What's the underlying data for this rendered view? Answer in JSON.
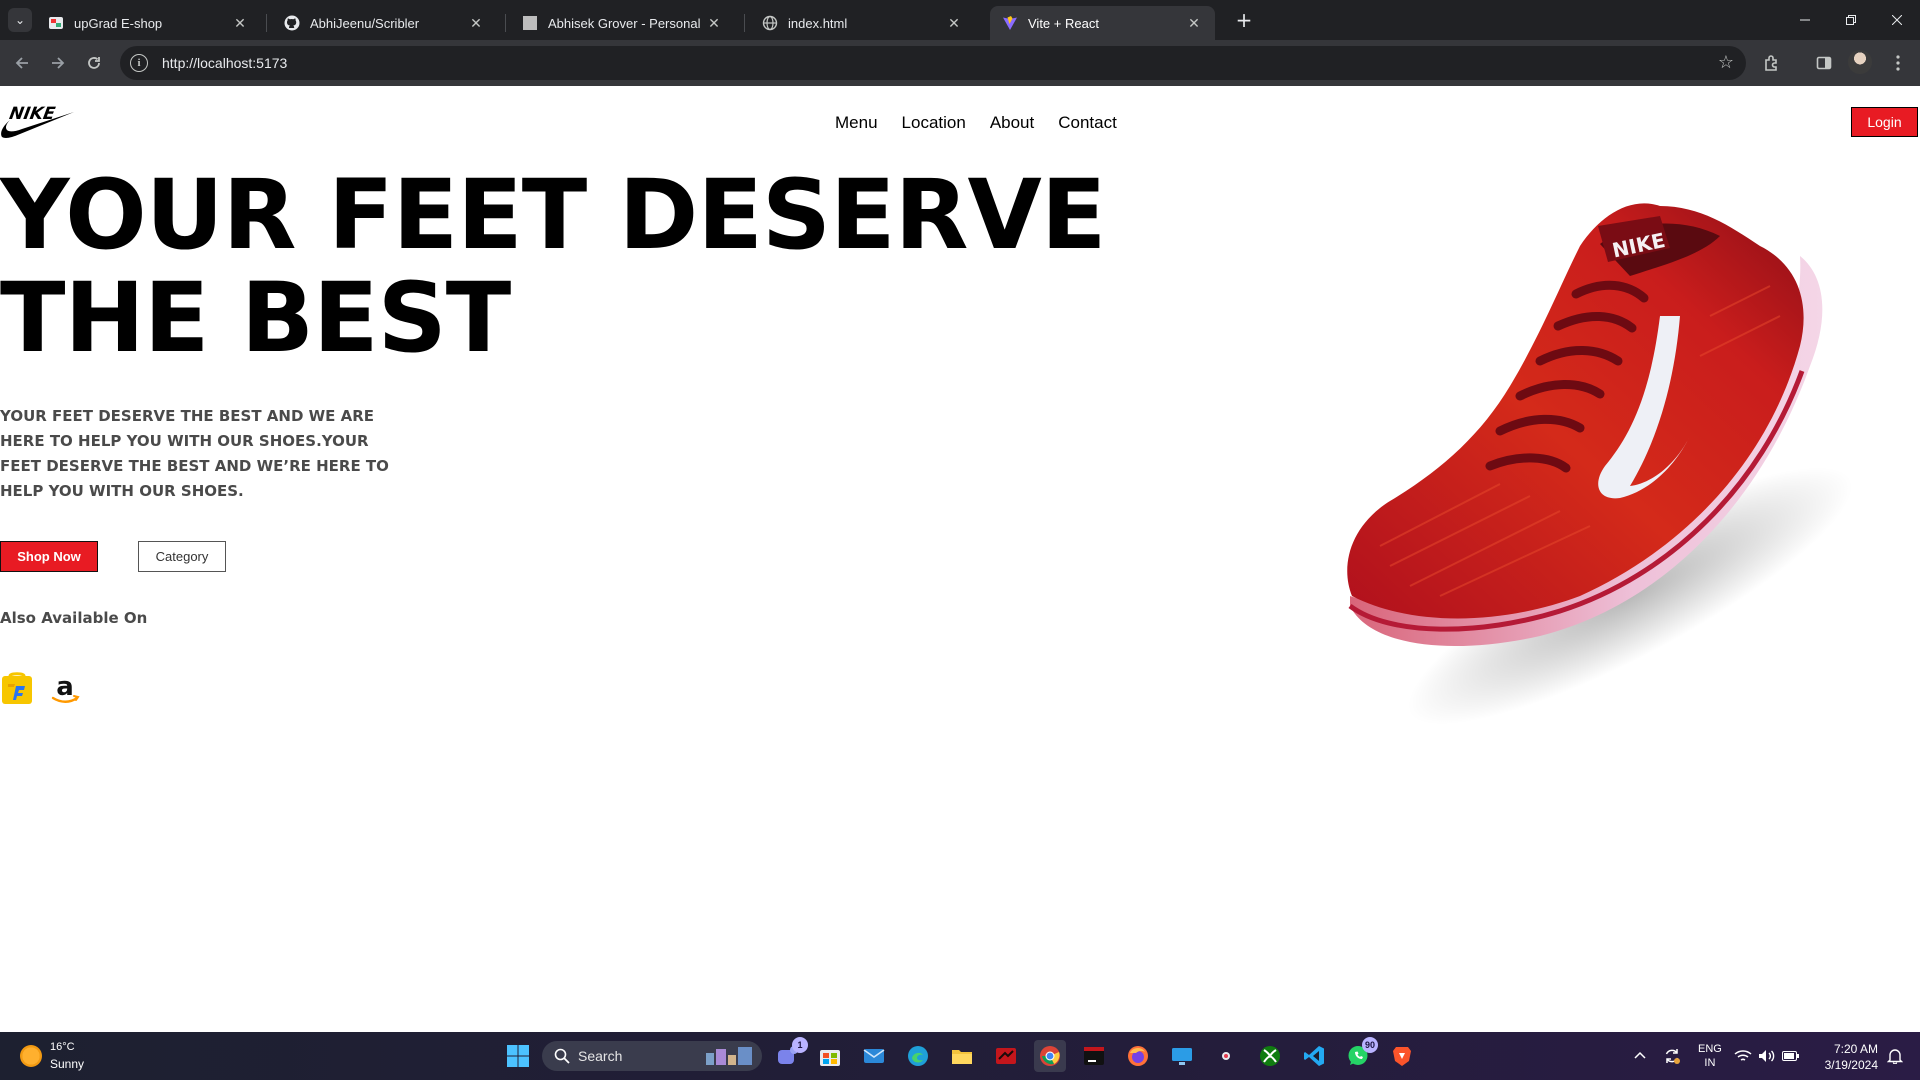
{
  "browser": {
    "tabs": [
      {
        "title": "upGrad E-shop",
        "active": false
      },
      {
        "title": "AbhiJeenu/Scribler",
        "active": false
      },
      {
        "title": "Abhisek Grover - Personal Portf",
        "active": false
      },
      {
        "title": "index.html",
        "active": false
      },
      {
        "title": "Vite + React",
        "active": true
      }
    ],
    "url": "http://localhost:5173"
  },
  "page": {
    "nav": [
      "Menu",
      "Location",
      "About",
      "Contact"
    ],
    "login": "Login",
    "hero_title": "YOUR FEET DESERVE THE BEST",
    "hero_description": "YOUR FEET DESERVE THE BEST AND WE ARE HERE TO HELP YOU WITH OUR SHOES.YOUR FEET DESERVE THE BEST AND WE’RE HERE TO HELP YOU WITH OUR SHOES.",
    "shop_now": "Shop Now",
    "category": "Category",
    "also_available": "Also Available On",
    "shoe_brand_text": "NIKE",
    "accent_color": "#e81b23"
  },
  "taskbar": {
    "weather_temp": "16°C",
    "weather_condition": "Sunny",
    "search_label": "Search",
    "teams_badge": "1",
    "whatsapp_badge": "90",
    "lang_top": "ENG",
    "lang_bottom": "IN",
    "time": "7:20 AM",
    "date": "3/19/2024"
  }
}
